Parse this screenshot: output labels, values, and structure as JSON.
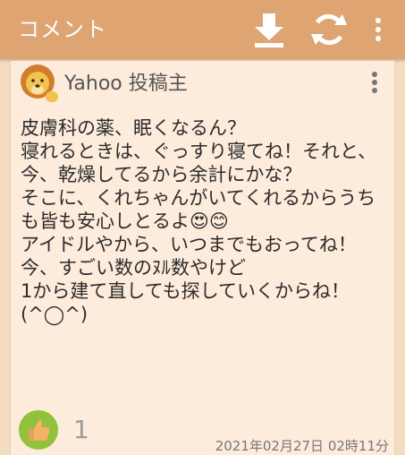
{
  "header": {
    "title": "コメント",
    "icons": [
      "download-icon",
      "refresh-icon",
      "more-vert-icon"
    ]
  },
  "comment": {
    "avatar_icon": "lion-icon",
    "user_name": "Yahoo 投稿主",
    "body": "皮膚科の薬、眠くなるん？\n寝れるときは、ぐっすり寝てね！それと、今、乾燥してるから余計にかな？\nそこに、くれちゃんがいてくれるからうちも皆も安心しとるよ😍😊\nアイドルやから、いつまでもおってね！\n今、すごい数のﾇﾙ数やけど\n1から建て直しても探していくからね！(^◯^)",
    "like_count": "1",
    "timestamp": "2021年02月27日 02時11分"
  },
  "colors": {
    "topbar": "#dea472",
    "background": "#f3dcbf",
    "card": "#fdebdc",
    "like_green": "#92c13c"
  }
}
